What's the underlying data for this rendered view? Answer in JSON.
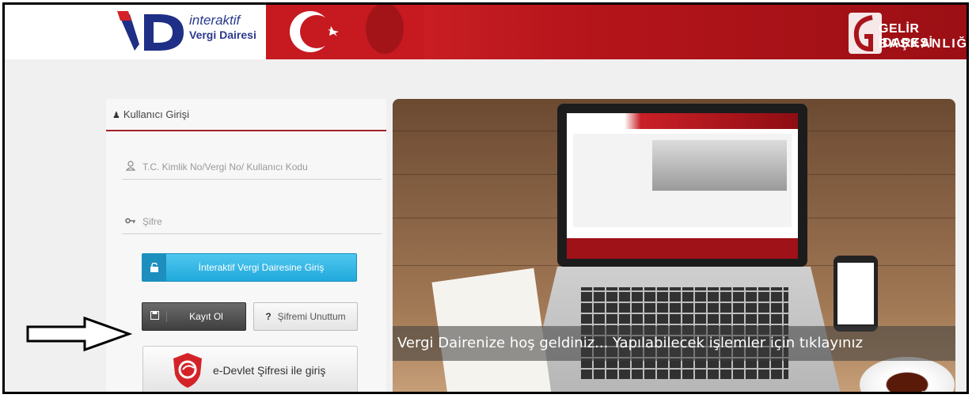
{
  "header": {
    "logo_line1": "interaktif",
    "logo_line2": "Vergi Dairesi",
    "org_line1": "GELİR İDARESİ",
    "org_line2": "BAŞKANLIĞI"
  },
  "login": {
    "title": "Kullanıcı Girişi",
    "user_placeholder": "T.C. Kimlik No/Vergi No/ Kullanıcı Kodu",
    "password_placeholder": "Şifre",
    "main_button": "İnteraktif Vergi Dairesine Giriş",
    "register_button": "Kayıt Ol",
    "forgot_button": "Şifremi Unuttum",
    "edevlet_button": "e-Devlet Şifresi ile giriş"
  },
  "slider": {
    "caption": "Vergi Dairenize hoş geldiniz... Yapılabilecek işlemler için tıklayınız"
  },
  "colors": {
    "brand_red": "#c0151c",
    "accent_blue": "#21a9dc",
    "dark_button": "#3f3f3f"
  }
}
